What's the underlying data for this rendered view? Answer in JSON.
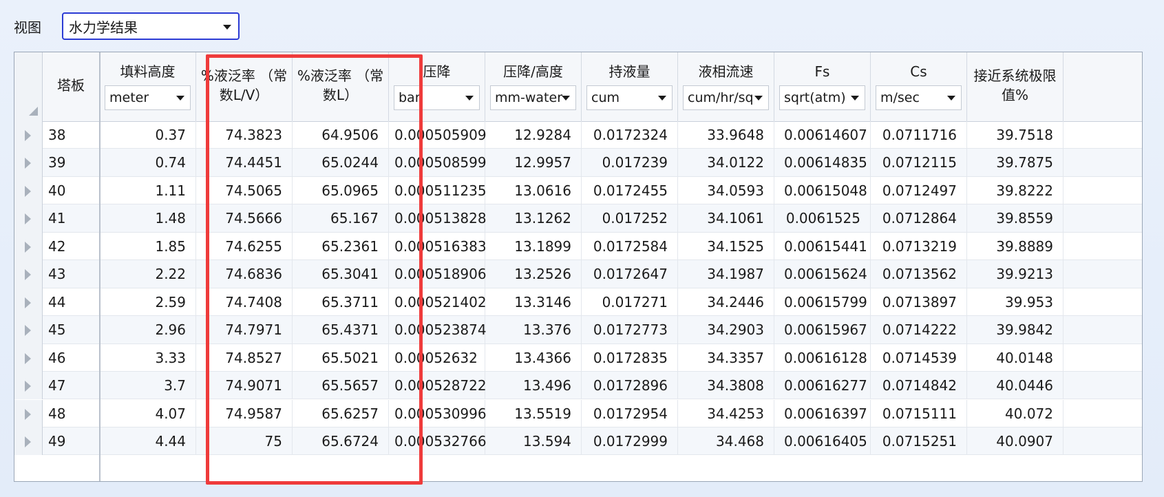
{
  "view": {
    "label": "视图",
    "selected": "水力学结果"
  },
  "columns": [
    {
      "key": "tray",
      "title": "塔板",
      "unit": null
    },
    {
      "key": "packing_height",
      "title": "填料高度",
      "unit": "meter"
    },
    {
      "key": "flood_lv",
      "title": "%液泛率 （常数L/V）",
      "title_lines": [
        "%液泛率 （常",
        "数L/V）"
      ],
      "unit": null
    },
    {
      "key": "flood_l",
      "title": "%液泛率 （常数L）",
      "title_lines": [
        "%液泛率 （常",
        "数L）"
      ],
      "unit": null
    },
    {
      "key": "pressure_drop",
      "title": "压降",
      "unit": "bar"
    },
    {
      "key": "pressure_drop_height",
      "title": "压降/高度",
      "unit": "mm-water"
    },
    {
      "key": "holdup",
      "title": "持液量",
      "unit": "cum"
    },
    {
      "key": "liquid_velocity",
      "title": "液相流速",
      "unit": "cum/hr/sq"
    },
    {
      "key": "fs",
      "title": "Fs",
      "unit": "sqrt(atm)"
    },
    {
      "key": "cs",
      "title": "Cs",
      "unit": "m/sec"
    },
    {
      "key": "approach_limit",
      "title": "接近系统极限值%",
      "title_lines": [
        "接近系统极限",
        "值%"
      ],
      "unit": null
    }
  ],
  "rows": [
    [
      "38",
      "0.37",
      "74.3823",
      "64.9506",
      "0.000505909",
      "12.9284",
      "0.0172324",
      "33.9648",
      "0.00614607",
      "0.0711716",
      "39.7518"
    ],
    [
      "39",
      "0.74",
      "74.4451",
      "65.0244",
      "0.000508599",
      "12.9957",
      "0.017239",
      "34.0122",
      "0.00614835",
      "0.0712115",
      "39.7875"
    ],
    [
      "40",
      "1.11",
      "74.5065",
      "65.0965",
      "0.000511235",
      "13.0616",
      "0.0172455",
      "34.0593",
      "0.00615048",
      "0.0712497",
      "39.8222"
    ],
    [
      "41",
      "1.48",
      "74.5666",
      "65.167",
      "0.000513828",
      "13.1262",
      "0.017252",
      "34.1061",
      "0.0061525",
      "0.0712864",
      "39.8559"
    ],
    [
      "42",
      "1.85",
      "74.6255",
      "65.2361",
      "0.000516383",
      "13.1899",
      "0.0172584",
      "34.1525",
      "0.00615441",
      "0.0713219",
      "39.8889"
    ],
    [
      "43",
      "2.22",
      "74.6836",
      "65.3041",
      "0.000518906",
      "13.2526",
      "0.0172647",
      "34.1987",
      "0.00615624",
      "0.0713562",
      "39.9213"
    ],
    [
      "44",
      "2.59",
      "74.7408",
      "65.3711",
      "0.000521402",
      "13.3146",
      "0.017271",
      "34.2446",
      "0.00615799",
      "0.0713897",
      "39.953"
    ],
    [
      "45",
      "2.96",
      "74.7971",
      "65.4371",
      "0.000523874",
      "13.376",
      "0.0172773",
      "34.2903",
      "0.00615967",
      "0.0714222",
      "39.9842"
    ],
    [
      "46",
      "3.33",
      "74.8527",
      "65.5021",
      "0.00052632",
      "13.4366",
      "0.0172835",
      "34.3357",
      "0.00616128",
      "0.0714539",
      "40.0148"
    ],
    [
      "47",
      "3.7",
      "74.9071",
      "65.5657",
      "0.000528722",
      "13.496",
      "0.0172896",
      "34.3808",
      "0.00616277",
      "0.0714842",
      "40.0446"
    ],
    [
      "48",
      "4.07",
      "74.9587",
      "65.6257",
      "0.000530996",
      "13.5519",
      "0.0172954",
      "34.4253",
      "0.00616397",
      "0.0715111",
      "40.072"
    ],
    [
      "49",
      "4.44",
      "75",
      "65.6724",
      "0.000532766",
      "13.594",
      "0.0172999",
      "34.468",
      "0.00616405",
      "0.0715251",
      "40.0907"
    ]
  ],
  "colors": {
    "highlight": "#ef3b3b",
    "select_focus": "#2c3bd4"
  }
}
